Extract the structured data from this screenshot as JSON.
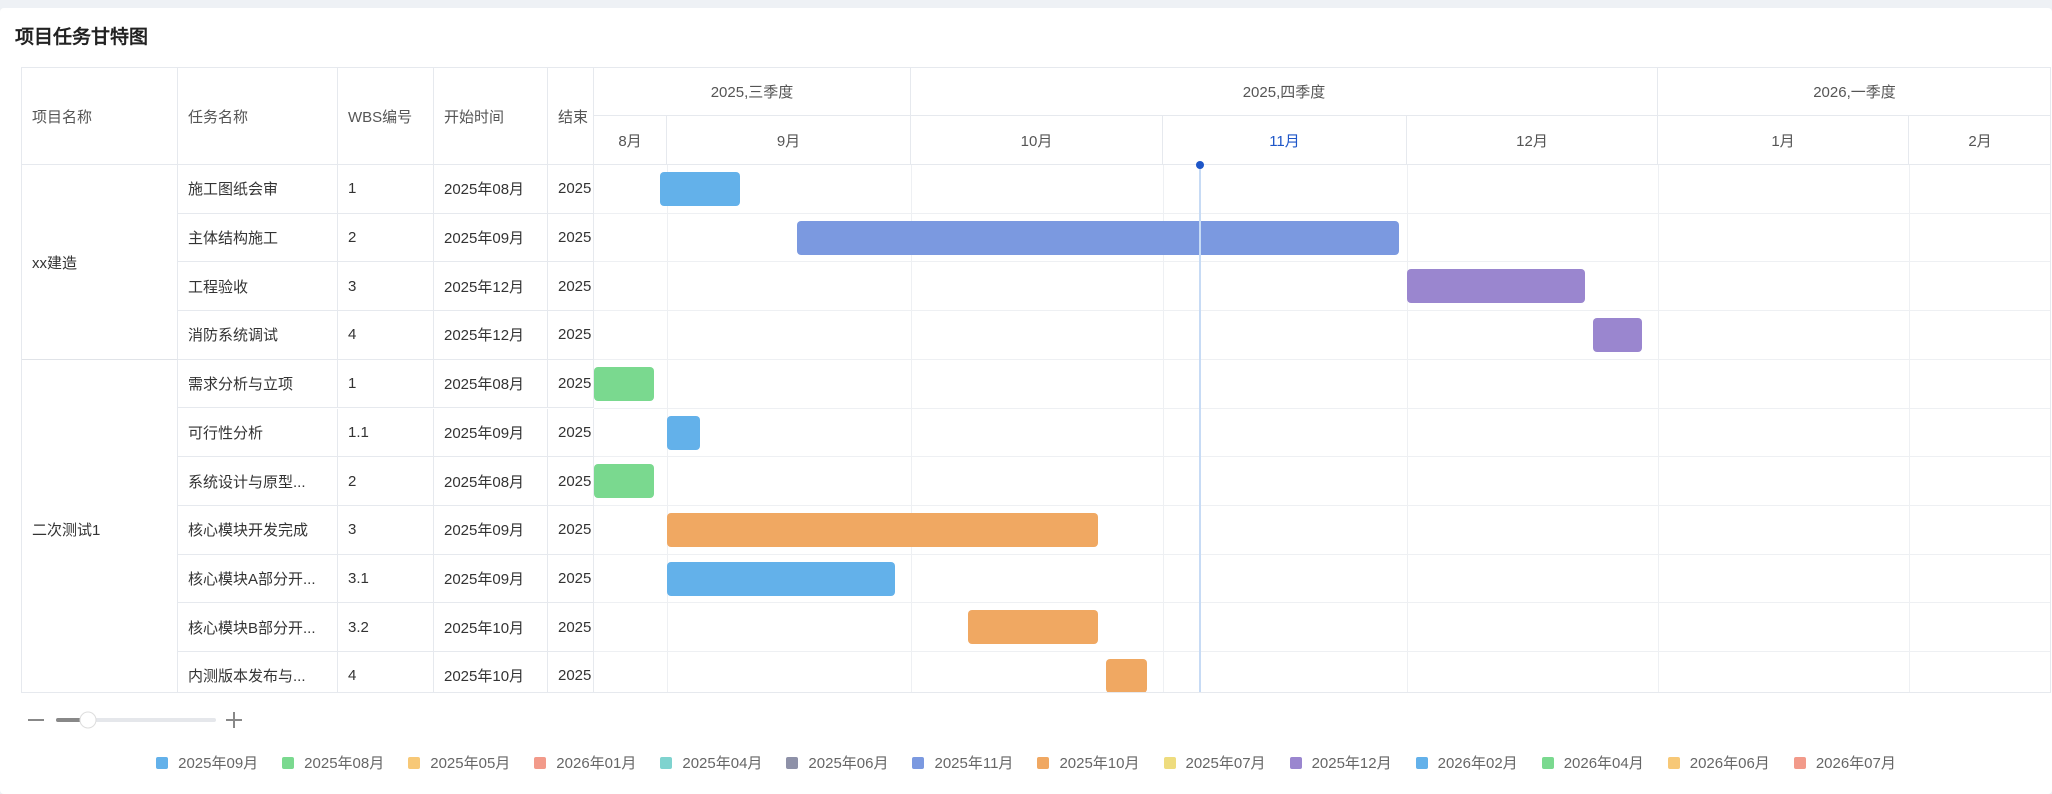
{
  "page_title": "项目任务甘特图",
  "columns": {
    "project": "项目名称",
    "task": "任务名称",
    "wbs": "WBS编号",
    "start": "开始时间",
    "end": "结束"
  },
  "quarters": [
    "2025,三季度",
    "2025,四季度",
    "2026,一季度"
  ],
  "months": [
    "8月",
    "9月",
    "10月",
    "11月",
    "12月",
    "1月",
    "2月"
  ],
  "current_month": "11月",
  "projects": [
    {
      "name": "xx建造"
    },
    {
      "name": "二次测试1"
    }
  ],
  "tasks": [
    {
      "project": 0,
      "name": "施工图纸会审",
      "wbs": "1",
      "start": "2025年08月",
      "end": "2025",
      "bar_start": "2025-08-31",
      "bar_end": "2025-09-10",
      "color": "#63b1ea"
    },
    {
      "project": 0,
      "name": "主体结构施工",
      "wbs": "2",
      "start": "2025年09月",
      "end": "2025",
      "bar_start": "2025-09-17",
      "bar_end": "2025-11-30",
      "color": "#7b99e0"
    },
    {
      "project": 0,
      "name": "工程验收",
      "wbs": "3",
      "start": "2025年12月",
      "end": "2025",
      "bar_start": "2025-12-01",
      "bar_end": "2025-12-23",
      "color": "#9a86cf"
    },
    {
      "project": 0,
      "name": "消防系统调试",
      "wbs": "4",
      "start": "2025年12月",
      "end": "2025",
      "bar_start": "2025-12-24",
      "bar_end": "2025-12-30",
      "color": "#9a86cf"
    },
    {
      "project": 1,
      "name": "需求分析与立项",
      "wbs": "1",
      "start": "2025年08月",
      "end": "2025",
      "bar_start": "2025-08-21",
      "bar_end": "2025-08-30",
      "color": "#7ad98f"
    },
    {
      "project": 1,
      "name": "可行性分析",
      "wbs": "1.1",
      "start": "2025年09月",
      "end": "2025",
      "bar_start": "2025-09-01",
      "bar_end": "2025-09-05",
      "color": "#63b1ea"
    },
    {
      "project": 1,
      "name": "系统设计与原型...",
      "wbs": "2",
      "start": "2025年08月",
      "end": "2025",
      "bar_start": "2025-08-21",
      "bar_end": "2025-08-30",
      "color": "#7ad98f"
    },
    {
      "project": 1,
      "name": "核心模块开发完成",
      "wbs": "3",
      "start": "2025年09月",
      "end": "2025",
      "bar_start": "2025-09-01",
      "bar_end": "2025-10-24",
      "color": "#f0a862"
    },
    {
      "project": 1,
      "name": "核心模块A部分开...",
      "wbs": "3.1",
      "start": "2025年09月",
      "end": "2025",
      "bar_start": "2025-09-01",
      "bar_end": "2025-09-29",
      "color": "#63b1ea"
    },
    {
      "project": 1,
      "name": "核心模块B部分开...",
      "wbs": "3.2",
      "start": "2025年10月",
      "end": "2025",
      "bar_start": "2025-10-08",
      "bar_end": "2025-10-24",
      "color": "#f0a862"
    },
    {
      "project": 1,
      "name": "内测版本发布与...",
      "wbs": "4",
      "start": "2025年10月",
      "end": "2025",
      "bar_start": "2025-10-25",
      "bar_end": "2025-10-30",
      "color": "#f0a862"
    }
  ],
  "legend": [
    {
      "label": "2025年09月",
      "color": "#63b1ea"
    },
    {
      "label": "2025年08月",
      "color": "#7ad98f"
    },
    {
      "label": "2025年05月",
      "color": "#f7c877"
    },
    {
      "label": "2026年01月",
      "color": "#f29a8a"
    },
    {
      "label": "2025年04月",
      "color": "#7fd3cf"
    },
    {
      "label": "2025年06月",
      "color": "#8e91a8"
    },
    {
      "label": "2025年11月",
      "color": "#7b99e0"
    },
    {
      "label": "2025年10月",
      "color": "#f0a862"
    },
    {
      "label": "2025年07月",
      "color": "#eedc7e"
    },
    {
      "label": "2025年12月",
      "color": "#9a86cf"
    },
    {
      "label": "2026年02月",
      "color": "#63b1ea"
    },
    {
      "label": "2026年04月",
      "color": "#7ad98f"
    },
    {
      "label": "2026年06月",
      "color": "#f7c877"
    },
    {
      "label": "2026年07月",
      "color": "#f29a8a"
    }
  ],
  "zoom_level": 0.2
}
